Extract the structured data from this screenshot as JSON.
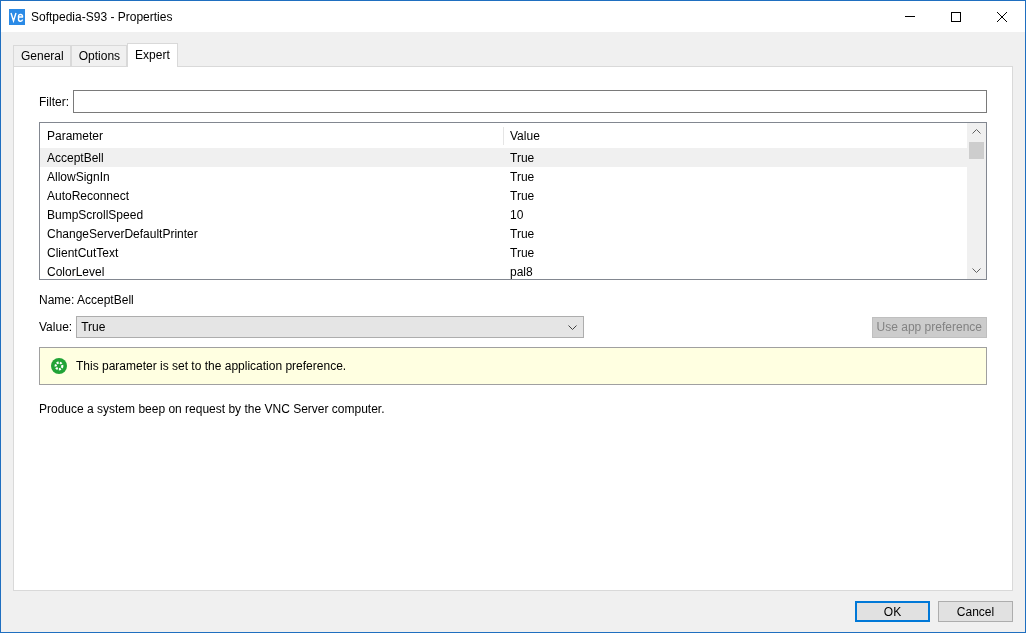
{
  "window": {
    "title": "Softpedia-S93 - Properties"
  },
  "tabs": [
    {
      "label": "General",
      "selected": false
    },
    {
      "label": "Options",
      "selected": false
    },
    {
      "label": "Expert",
      "selected": true
    }
  ],
  "filter": {
    "label": "Filter:"
  },
  "table": {
    "columns": [
      "Parameter",
      "Value"
    ],
    "rows": [
      {
        "cells": [
          "AcceptBell",
          "True"
        ],
        "selected": true
      },
      {
        "cells": [
          "AllowSignIn",
          "True"
        ],
        "selected": false
      },
      {
        "cells": [
          "AutoReconnect",
          "True"
        ],
        "selected": false
      },
      {
        "cells": [
          "BumpScrollSpeed",
          "10"
        ],
        "selected": false
      },
      {
        "cells": [
          "ChangeServerDefaultPrinter",
          "True"
        ],
        "selected": false
      },
      {
        "cells": [
          "ClientCutText",
          "True"
        ],
        "selected": false
      },
      {
        "cells": [
          "ColorLevel",
          "pal8"
        ],
        "selected": false
      }
    ]
  },
  "detail": {
    "name_label": "Name:",
    "name_value": "AcceptBell",
    "value_label": "Value:",
    "value": "True",
    "preference_button": {
      "label": "Use app preference",
      "disabled": true
    },
    "info": "This parameter is set to the application preference.",
    "description": "Produce a system beep on request by the VNC Server computer."
  },
  "buttons": [
    {
      "label": "OK",
      "default": true
    },
    {
      "label": "Cancel",
      "default": false
    }
  ]
}
